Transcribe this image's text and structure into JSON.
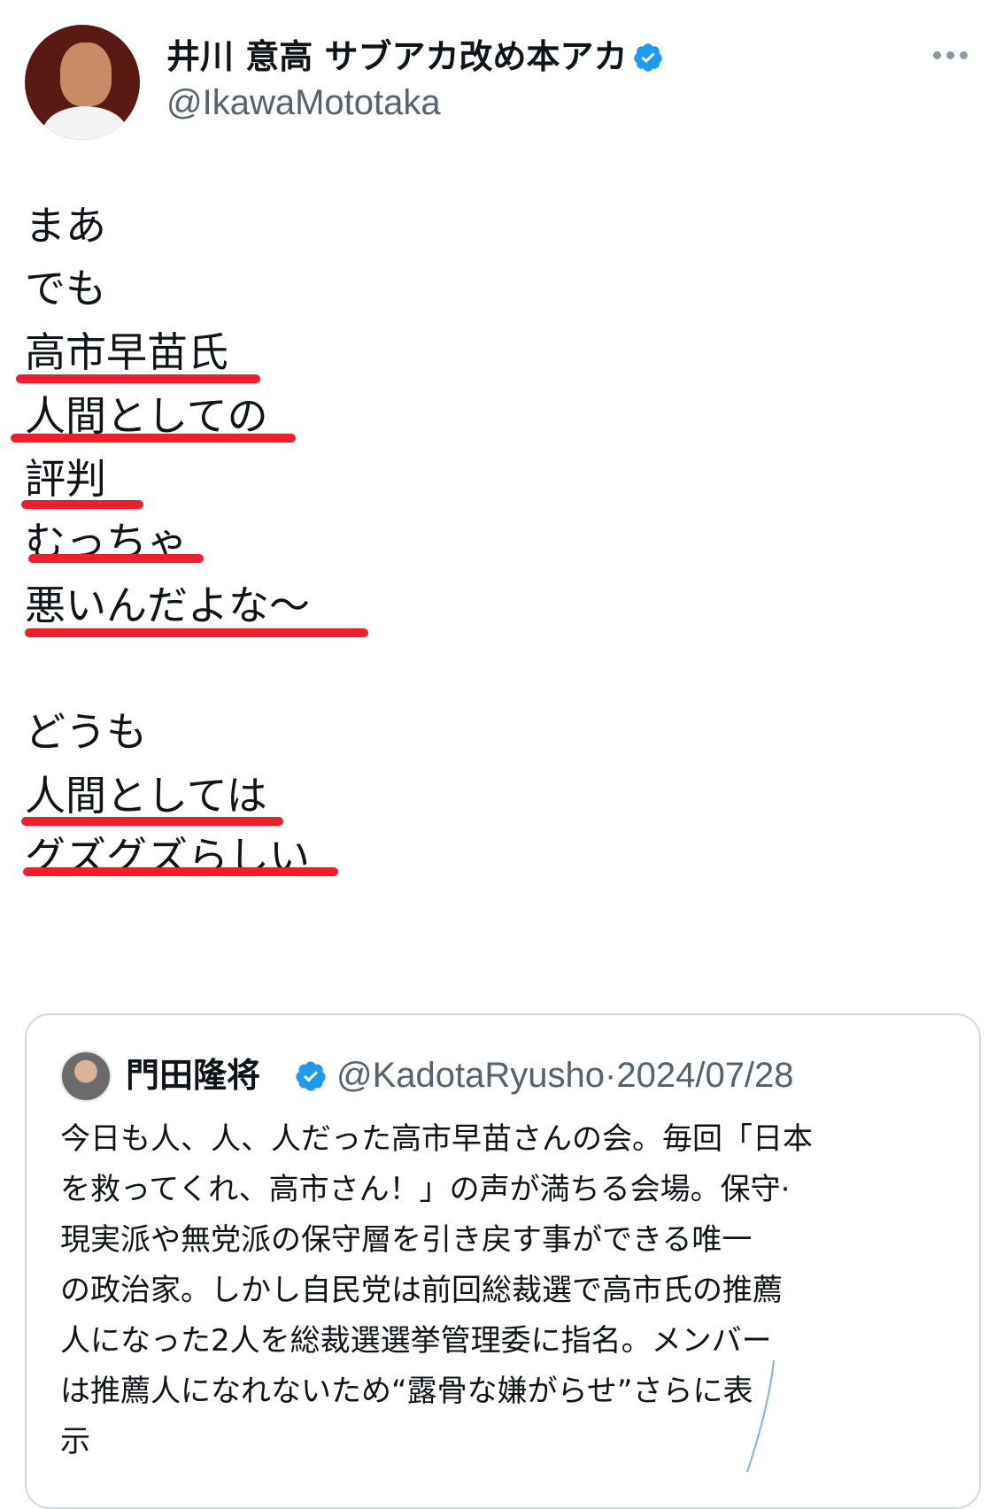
{
  "author": {
    "display_name": "井川 意高 サブアカ改め本アカ",
    "handle": "@IkawaMototaka",
    "verified_icon": "verified-badge-icon",
    "more_icon": "more-options-icon"
  },
  "tweet": {
    "lines": [
      "まあ",
      "でも",
      "高市早苗氏",
      "人間としての",
      "評判",
      "むっちゃ",
      "悪いんだよな〜",
      "どうも",
      "人間としては",
      "グズグズらしい"
    ],
    "underline_color": "#f21d2a"
  },
  "quote": {
    "display_name": "門田隆将",
    "handle": "@KadotaRyusho",
    "separator": "·",
    "date": "2024/07/28",
    "text_lines": [
      "今日も人、人、人だった高市早苗さんの会。毎回「日本",
      "を救ってくれ、高市さん！」の声が満ちる会場。保守·",
      "現実派や無党派の保守層を引き戻す事ができる唯一",
      "の政治家。しかし自民党は前回総裁選で高市氏の推薦",
      "人になった2人を総裁選選挙管理委に指名。メンバー",
      "は推薦人になれないため“露骨な嫌がらせ”さらに表",
      "示"
    ]
  },
  "colors": {
    "text": "#0f1419",
    "secondary": "#536471",
    "verified_blue": "#1d9bf0",
    "border": "#cfd9de"
  }
}
